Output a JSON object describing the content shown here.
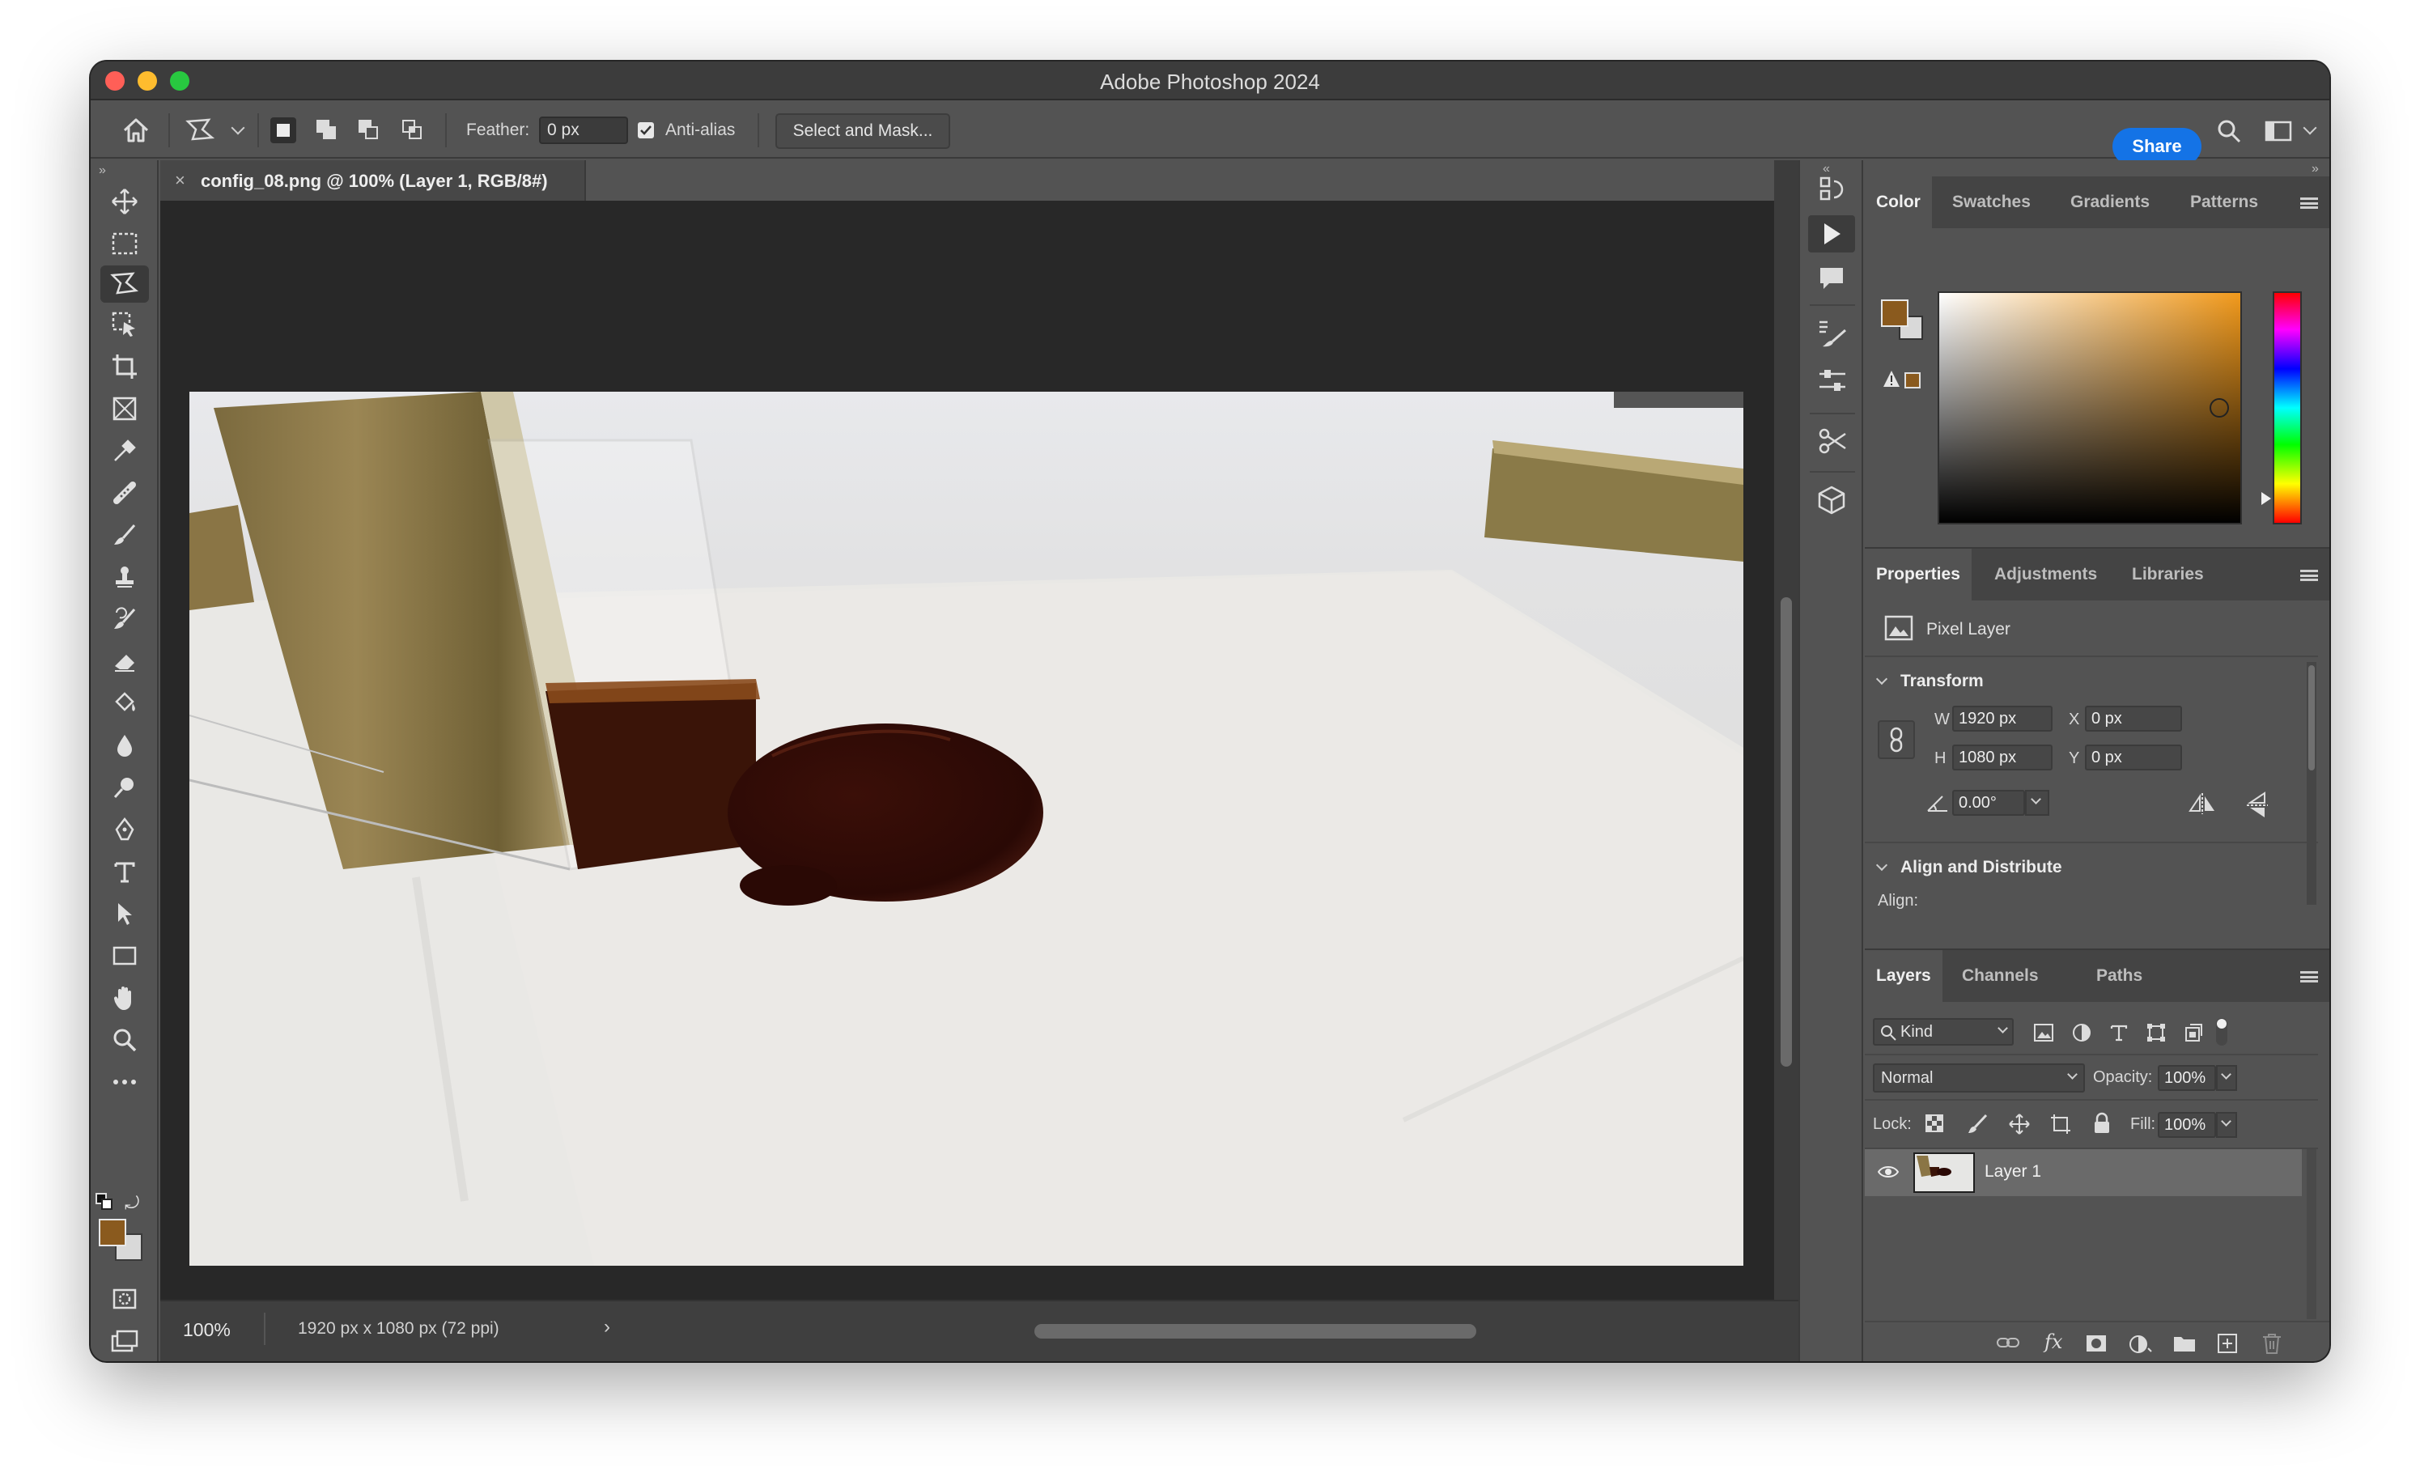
{
  "window": {
    "title": "Adobe Photoshop 2024",
    "traffic_colors": [
      "#ff5f57",
      "#febc2e",
      "#28c840"
    ]
  },
  "options_bar": {
    "home_icon": "home-icon",
    "tool_preset_icon": "polygonal-lasso-icon",
    "selection_modes": [
      "new-selection",
      "add-to-selection",
      "subtract-from-selection",
      "intersect-with-selection"
    ],
    "feather_label": "Feather:",
    "feather_value": "0 px",
    "anti_alias_label": "Anti-alias",
    "anti_alias_checked": true,
    "select_and_mask_label": "Select and Mask...",
    "share_label": "Share"
  },
  "toolbar": {
    "tools": [
      {
        "name": "move-tool",
        "icon": "move-icon"
      },
      {
        "name": "rectangular-marquee-tool",
        "icon": "marquee-icon"
      },
      {
        "name": "polygonal-lasso-tool",
        "icon": "polygonal-lasso-icon",
        "active": true
      },
      {
        "name": "object-selection-tool",
        "icon": "object-selection-icon"
      },
      {
        "name": "crop-tool",
        "icon": "crop-icon"
      },
      {
        "name": "frame-tool",
        "icon": "frame-icon"
      },
      {
        "name": "eyedropper-tool",
        "icon": "eyedropper-icon"
      },
      {
        "name": "spot-healing-tool",
        "icon": "healing-brush-icon"
      },
      {
        "name": "brush-tool",
        "icon": "brush-icon"
      },
      {
        "name": "clone-stamp-tool",
        "icon": "stamp-icon"
      },
      {
        "name": "history-brush-tool",
        "icon": "history-brush-icon"
      },
      {
        "name": "eraser-tool",
        "icon": "eraser-icon"
      },
      {
        "name": "paint-bucket-tool",
        "icon": "paint-bucket-icon"
      },
      {
        "name": "blur-tool",
        "icon": "blur-drop-icon"
      },
      {
        "name": "dodge-tool",
        "icon": "dodge-icon"
      },
      {
        "name": "pen-tool",
        "icon": "pen-icon"
      },
      {
        "name": "type-tool",
        "icon": "type-icon"
      },
      {
        "name": "path-selection-tool",
        "icon": "path-selection-icon"
      },
      {
        "name": "rectangle-tool",
        "icon": "rectangle-icon"
      },
      {
        "name": "hand-tool",
        "icon": "hand-icon"
      },
      {
        "name": "zoom-tool",
        "icon": "zoom-icon"
      },
      {
        "name": "edit-toolbar",
        "icon": "more-icon"
      }
    ],
    "foreground_color": "#8a5a1e",
    "background_color": "#d9d9d9"
  },
  "document": {
    "tab_title": "config_08.png @ 100% (Layer 1, RGB/8#)",
    "zoom": "100%",
    "info": "1920 px x 1080 px (72 ppi)"
  },
  "color_panel": {
    "tabs": [
      "Color",
      "Swatches",
      "Gradients",
      "Patterns"
    ],
    "active_tab": "Color",
    "hue_color": "#f29a1c",
    "foreground_color": "#8a5a1e",
    "background_color": "#d9d9d9"
  },
  "properties_panel": {
    "tabs": [
      "Properties",
      "Adjustments",
      "Libraries"
    ],
    "active_tab": "Properties",
    "layer_type": "Pixel Layer",
    "transform_label": "Transform",
    "w_label": "W",
    "w_value": "1920 px",
    "h_label": "H",
    "h_value": "1080 px",
    "x_label": "X",
    "x_value": "0 px",
    "y_label": "Y",
    "y_value": "0 px",
    "angle_value": "0.00°",
    "align_label": "Align and Distribute",
    "align_sub": "Align:"
  },
  "layers_panel": {
    "tabs": [
      "Layers",
      "Channels",
      "Paths"
    ],
    "active_tab": "Layers",
    "filter_label": "Kind",
    "blend_mode": "Normal",
    "opacity_label": "Opacity:",
    "opacity_value": "100%",
    "lock_label": "Lock:",
    "fill_label": "Fill:",
    "fill_value": "100%",
    "layers": [
      {
        "name": "Layer 1",
        "visible": true
      }
    ]
  }
}
